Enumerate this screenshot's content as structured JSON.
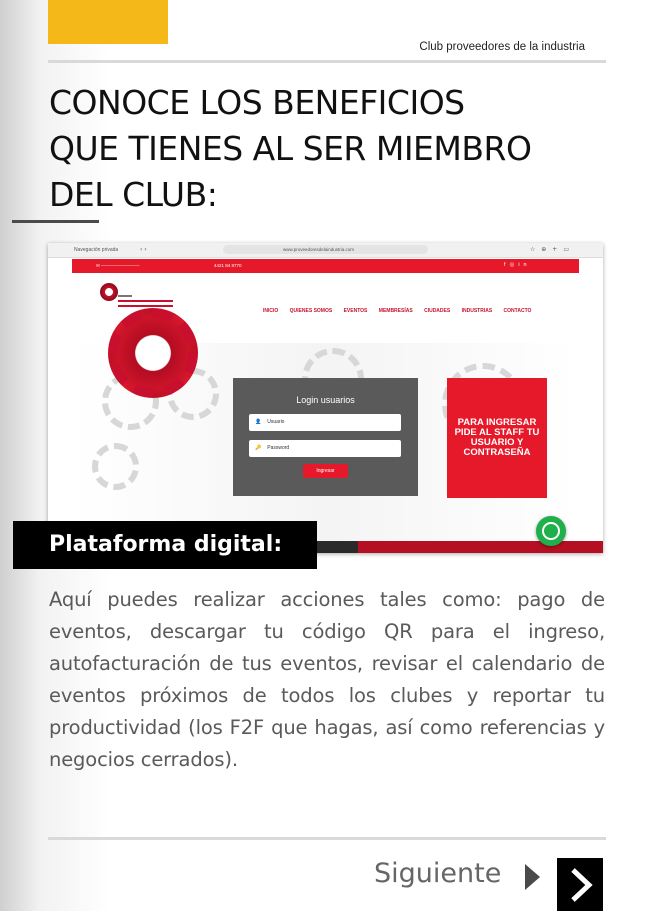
{
  "header": {
    "label": "Club proveedores de la industria"
  },
  "title": {
    "line1": "CONOCE LOS BENEFICIOS",
    "line2": "QUE TIENES AL SER MIEMBRO",
    "line3": "DEL CLUB:"
  },
  "colors": {
    "accent_yellow": "#f4b919",
    "brand_red": "#e5192a",
    "dark": "#000000",
    "text_gray": "#5a5a5a",
    "whatsapp_green": "#1fb04b"
  },
  "screenshot": {
    "browser_tab": "Navegación privada",
    "url": "www.proveedoresdelaindustria.com",
    "contact_phone": "4421 84 8770",
    "menu": [
      "INICIO",
      "QUIENES SOMOS",
      "EVENTOS",
      "MEMBRESÍAS",
      "CIUDADES",
      "INDUSTRIAS",
      "CONTACTO"
    ],
    "login": {
      "title": "Login usuarios",
      "user_placeholder": "Usuario",
      "password_placeholder": "Password",
      "button": "Ingresar"
    },
    "staff_note": "PARA INGRESAR PIDE AL STAFF TU USUARIO Y CONTRASEÑA"
  },
  "section_label": "Plataforma digital:",
  "body": "Aquí puedes realizar acciones tales como: pago de eventos, descargar tu código QR para el ingreso, autofacturación de tus eventos, revisar el calendario de eventos próximos de todos los clubes y reportar tu productividad (los F2F que hagas, así como referencias y negocios cerrados).",
  "footer": {
    "next_label": "Siguiente",
    "next_icon": "chevron-right-icon"
  }
}
